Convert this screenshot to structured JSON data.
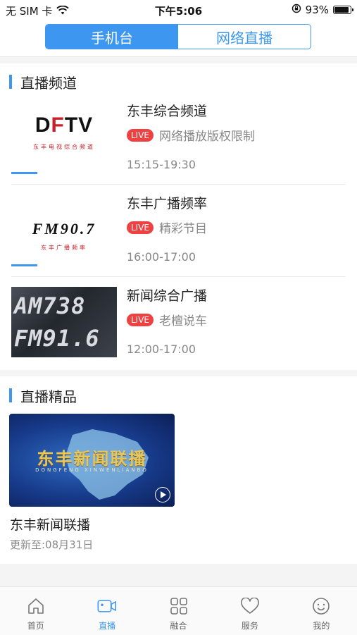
{
  "status_bar": {
    "carrier": "无 SIM 卡",
    "time": "下午5:06",
    "battery_percent": "93%",
    "battery_level": 0.93
  },
  "segmented": {
    "tabs": [
      {
        "label": "手机台",
        "active": true
      },
      {
        "label": "网络直播",
        "active": false
      }
    ]
  },
  "live_channels": {
    "title": "直播频道",
    "items": [
      {
        "name": "东丰综合频道",
        "badge": "LIVE",
        "program": "网络播放版权限制",
        "time": "15:15-19:30",
        "logo": {
          "main": "DFTV",
          "sub": "东丰电视综合频道"
        }
      },
      {
        "name": "东丰广播频率",
        "badge": "LIVE",
        "program": "精彩节目",
        "time": "16:00-17:00",
        "logo": {
          "main": "FM90.7",
          "sub": "东丰广播频率"
        }
      },
      {
        "name": "新闻综合广播",
        "badge": "LIVE",
        "program": "老檀说车",
        "time": "12:00-17:00",
        "logo": {
          "line1": "AM738",
          "line2": "FM91.6"
        }
      }
    ]
  },
  "featured": {
    "title": "直播精品",
    "item": {
      "art_title": "东丰新闻联播",
      "art_sub": "DONGFENG XINWENLIANBO",
      "name": "东丰新闻联播",
      "updated": "更新至:08月31日"
    }
  },
  "tab_bar": {
    "items": [
      {
        "label": "首页",
        "icon": "home-icon"
      },
      {
        "label": "直播",
        "icon": "video-camera-icon",
        "active": true
      },
      {
        "label": "融合",
        "icon": "grid-icon"
      },
      {
        "label": "服务",
        "icon": "heart-icon"
      },
      {
        "label": "我的",
        "icon": "smile-icon"
      }
    ]
  },
  "colors": {
    "accent": "#3d97f0",
    "live_badge": "#ef4141",
    "brand_red": "#c8202a"
  }
}
